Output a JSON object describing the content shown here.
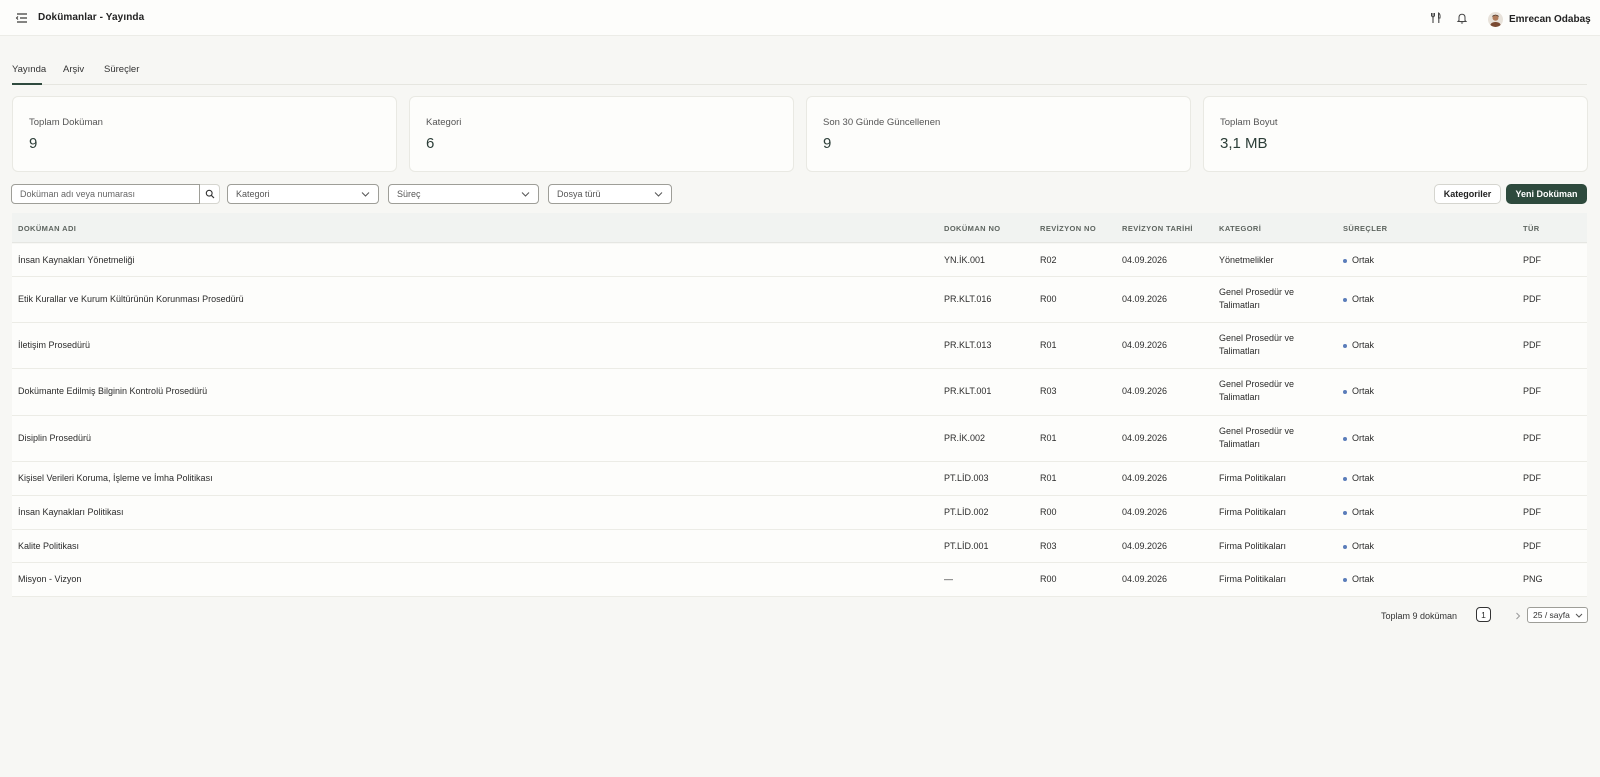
{
  "header": {
    "title": "Dokümanlar - Yayında",
    "user_name": "Emrecan Odabaş",
    "icons": [
      "menu-icon",
      "utensils-icon",
      "bell-icon",
      "user-avatar"
    ]
  },
  "tabs": [
    {
      "label": "Yayında",
      "active": true
    },
    {
      "label": "Arşiv",
      "active": false
    },
    {
      "label": "Süreçler",
      "active": false
    }
  ],
  "stats": [
    {
      "label": "Toplam Doküman",
      "value": "9"
    },
    {
      "label": "Kategori",
      "value": "6"
    },
    {
      "label": "Son 30 Günde Güncellenen",
      "value": "9"
    },
    {
      "label": "Toplam Boyut",
      "value": "3,1 MB"
    }
  ],
  "filters": {
    "search_placeholder": "Doküman adı veya numarası",
    "search_value": "",
    "category_placeholder": "Kategori",
    "process_placeholder": "Süreç",
    "filetype_placeholder": "Dosya türü"
  },
  "actions": {
    "categories_label": "Kategoriler",
    "new_doc_label": "Yeni Doküman"
  },
  "table": {
    "columns": [
      "DOKÜMAN ADI",
      "DOKÜMAN NO",
      "REVİZYON NO",
      "REVİZYON TARİHİ",
      "KATEGORİ",
      "SÜREÇLER",
      "TÜR"
    ],
    "rows": [
      {
        "name": "İnsan Kaynakları Yönetmeliği",
        "no": "YN.İK.001",
        "rev": "R02",
        "date": "04.09.2026",
        "category": "Yönetmelikler",
        "process": "Ortak",
        "type": "PDF"
      },
      {
        "name": "Etik Kurallar ve Kurum Kültürünün Korunması Prosedürü",
        "no": "PR.KLT.016",
        "rev": "R00",
        "date": "04.09.2026",
        "category": "Genel Prosedür ve Talimatları",
        "process": "Ortak",
        "type": "PDF"
      },
      {
        "name": "İletişim Prosedürü",
        "no": "PR.KLT.013",
        "rev": "R01",
        "date": "04.09.2026",
        "category": "Genel Prosedür ve Talimatları",
        "process": "Ortak",
        "type": "PDF"
      },
      {
        "name": "Dokümante Edilmiş Bilginin Kontrolü Prosedürü",
        "no": "PR.KLT.001",
        "rev": "R03",
        "date": "04.09.2026",
        "category": "Genel Prosedür ve Talimatları",
        "process": "Ortak",
        "type": "PDF"
      },
      {
        "name": "Disiplin Prosedürü",
        "no": "PR.İK.002",
        "rev": "R01",
        "date": "04.09.2026",
        "category": "Genel Prosedür ve Talimatları",
        "process": "Ortak",
        "type": "PDF"
      },
      {
        "name": "Kişisel Verileri Koruma, İşleme ve İmha Politikası",
        "no": "PT.LİD.003",
        "rev": "R01",
        "date": "04.09.2026",
        "category": "Firma Politikaları",
        "process": "Ortak",
        "type": "PDF"
      },
      {
        "name": "İnsan Kaynakları Politikası",
        "no": "PT.LİD.002",
        "rev": "R00",
        "date": "04.09.2026",
        "category": "Firma Politikaları",
        "process": "Ortak",
        "type": "PDF"
      },
      {
        "name": "Kalite Politikası",
        "no": "PT.LİD.001",
        "rev": "R03",
        "date": "04.09.2026",
        "category": "Firma Politikaları",
        "process": "Ortak",
        "type": "PDF"
      },
      {
        "name": "Misyon - Vizyon",
        "no": "—",
        "rev": "R00",
        "date": "04.09.2026",
        "category": "Firma Politikaları",
        "process": "Ortak",
        "type": "PNG"
      }
    ]
  },
  "pagination": {
    "total_label": "Toplam 9 doküman",
    "current_page": "1",
    "page_size_label": "25 / sayfa"
  },
  "colors": {
    "primary": "#2e4a3d",
    "process_dot": "#5b7dba",
    "background": "#f7f7f4"
  }
}
